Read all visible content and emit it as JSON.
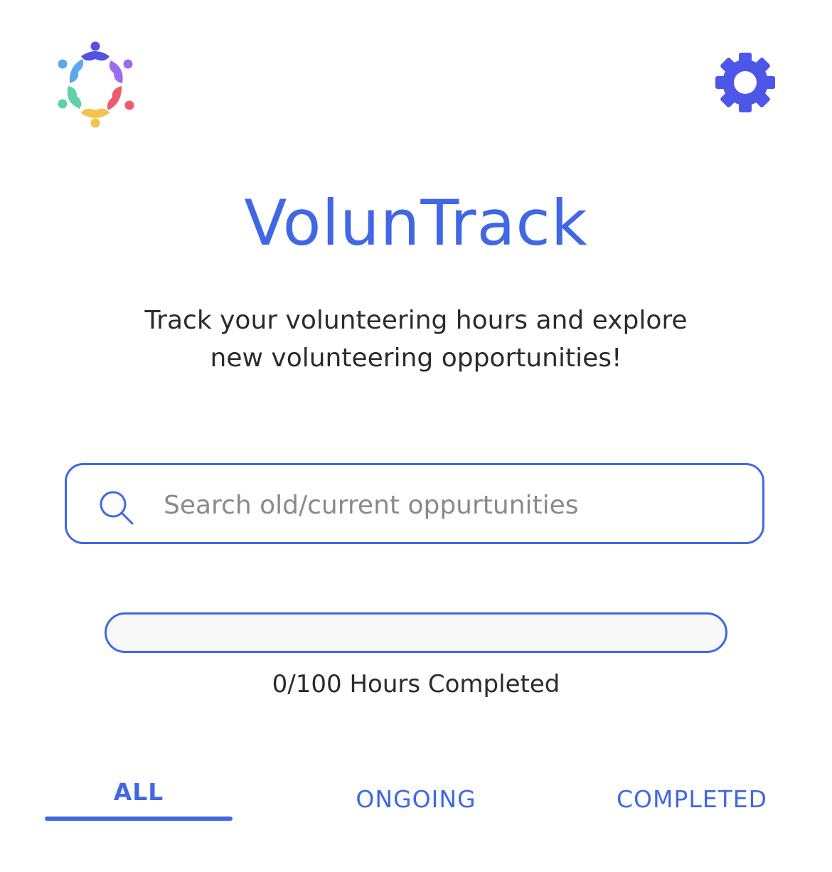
{
  "header": {
    "logo_icon": "community-hands-logo-icon",
    "settings_icon": "gear-icon"
  },
  "app": {
    "title": "VolunTrack",
    "subtitle_line1": "Track your volunteering hours and explore",
    "subtitle_line2": "new volunteering opportunities!"
  },
  "search": {
    "icon": "search-icon",
    "value": "",
    "placeholder": "Search old/current oppurtunities"
  },
  "progress": {
    "hours_completed": 0,
    "hours_goal": 100,
    "fraction": 0,
    "label": "0/100 Hours Completed"
  },
  "tabs": [
    {
      "label": "ALL",
      "active": true
    },
    {
      "label": "ONGOING",
      "active": false
    },
    {
      "label": "COMPLETED",
      "active": false
    }
  ],
  "colors": {
    "accent": "#4068e4",
    "text": "#2b2b2b",
    "placeholder": "#8a8a8a",
    "logo_blue": "#5aa8ee",
    "logo_indigo": "#5452e0",
    "logo_purple": "#9b6cf0",
    "logo_red": "#ee5a6e",
    "logo_yellow": "#f5c24e",
    "logo_green": "#5ed1a6"
  }
}
